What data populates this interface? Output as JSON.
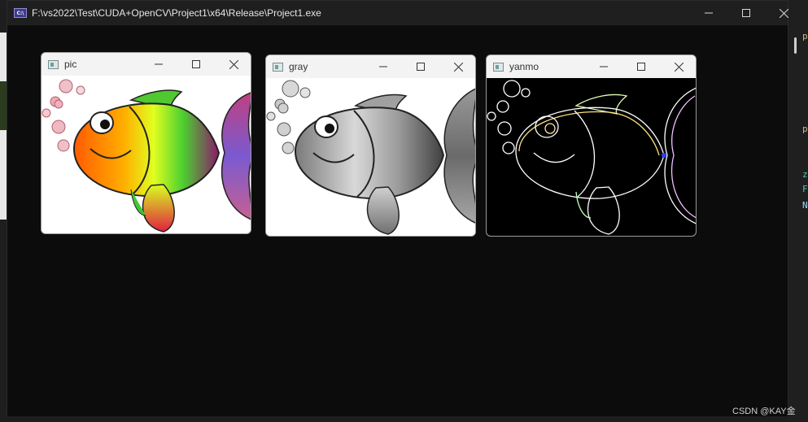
{
  "console": {
    "title": "F:\\vs2022\\Test\\CUDA+OpenCV\\Project1\\x64\\Release\\Project1.exe",
    "icon_text": "C:\\",
    "icon": "console-app-icon",
    "minimize_icon": "minimize-icon",
    "maximize_icon": "maximize-icon",
    "close_icon": "close-icon"
  },
  "windows": [
    {
      "title": "pic",
      "image": "colorful-fish"
    },
    {
      "title": "gray",
      "image": "grayscale-fish"
    },
    {
      "title": "yanmo",
      "image": "edge-mask-fish"
    }
  ],
  "ide_fragments": [
    "p",
    "p",
    "z",
    "F",
    "N"
  ],
  "watermark": "CSDN @KAY金",
  "colors": {
    "console_bg": "#0c0c0c",
    "titlebar_bg": "#1f1f1f",
    "ide_green": "#4ec9b0"
  }
}
